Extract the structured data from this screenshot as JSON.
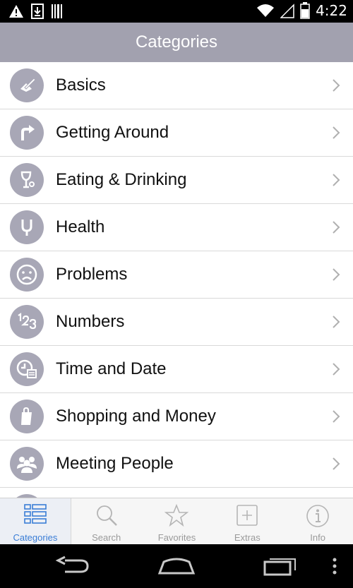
{
  "status": {
    "time": "4:22"
  },
  "header": {
    "title": "Categories"
  },
  "categories": [
    {
      "label": "Basics",
      "icon": "pencil-paper-icon"
    },
    {
      "label": "Getting Around",
      "icon": "turn-arrow-icon"
    },
    {
      "label": "Eating & Drinking",
      "icon": "glass-icon"
    },
    {
      "label": "Health",
      "icon": "stethoscope-icon"
    },
    {
      "label": "Problems",
      "icon": "sad-face-icon"
    },
    {
      "label": "Numbers",
      "icon": "numbers-icon"
    },
    {
      "label": "Time and Date",
      "icon": "clock-calendar-icon"
    },
    {
      "label": "Shopping and Money",
      "icon": "shopping-bag-icon"
    },
    {
      "label": "Meeting People",
      "icon": "people-icon"
    }
  ],
  "tabs": [
    {
      "label": "Categories",
      "icon": "list-icon",
      "active": true
    },
    {
      "label": "Search",
      "icon": "search-icon",
      "active": false
    },
    {
      "label": "Favorites",
      "icon": "star-icon",
      "active": false
    },
    {
      "label": "Extras",
      "icon": "plus-box-icon",
      "active": false
    },
    {
      "label": "Info",
      "icon": "info-icon",
      "active": false
    }
  ],
  "colors": {
    "header": "#a2a1af",
    "icon_circle": "#a8a7b6",
    "active_tab": "#3a7dd6"
  }
}
